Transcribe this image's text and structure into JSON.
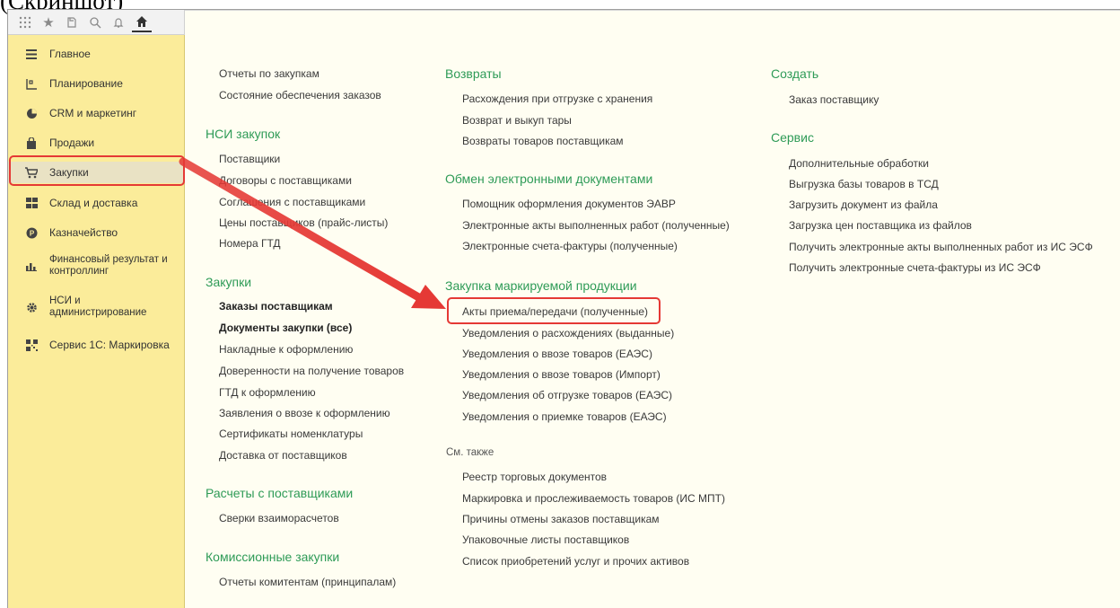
{
  "page_fragment": "(Скриншот)",
  "toolbar": {
    "icons": [
      "apps-grid-icon",
      "star-icon",
      "history-icon",
      "search-icon",
      "bell-icon",
      "home-icon"
    ]
  },
  "sidebar": {
    "items": [
      {
        "label": "Главное",
        "icon": "menu-lines-icon"
      },
      {
        "label": "Планирование",
        "icon": "planning-icon"
      },
      {
        "label": "CRM и маркетинг",
        "icon": "crm-pie-icon"
      },
      {
        "label": "Продажи",
        "icon": "shopping-bag-icon"
      },
      {
        "label": "Закупки",
        "icon": "cart-icon"
      },
      {
        "label": "Склад и доставка",
        "icon": "warehouse-icon"
      },
      {
        "label": "Казначейство",
        "icon": "coin-icon"
      },
      {
        "label": "Финансовый результат и контроллинг",
        "icon": "bar-chart-icon"
      },
      {
        "label": "НСИ и администрирование",
        "icon": "gear-icon"
      },
      {
        "label": "Сервис 1С: Маркировка",
        "icon": "qr-code-icon"
      }
    ],
    "active_index": 4
  },
  "col1": {
    "top_links": [
      "Отчеты по закупкам",
      "Состояние обеспечения заказов"
    ],
    "nsi_title": "НСИ закупок",
    "nsi_links": [
      "Поставщики",
      "Договоры с поставщиками",
      "Соглашения с поставщиками",
      "Цены поставщиков (прайс-листы)",
      "Номера ГТД"
    ],
    "purchases_title": "Закупки",
    "purchases_bold": [
      "Заказы поставщикам",
      "Документы закупки (все)"
    ],
    "purchases_links": [
      "Накладные к оформлению",
      "Доверенности на получение товаров",
      "ГТД к оформлению",
      "Заявления о ввозе к оформлению",
      "Сертификаты номенклатуры",
      "Доставка от поставщиков"
    ],
    "settlements_title": "Расчеты с поставщиками",
    "settlements_links": [
      "Сверки взаиморасчетов"
    ],
    "commission_title": "Комиссионные закупки",
    "commission_links": [
      "Отчеты комитентам (принципалам)"
    ]
  },
  "col2": {
    "returns_title": "Возвраты",
    "returns_links": [
      "Расхождения при отгрузке с хранения",
      "Возврат и выкуп тары",
      "Возвраты товаров поставщикам"
    ],
    "edo_title": "Обмен электронными документами",
    "edo_links": [
      "Помощник оформления документов ЭАВР",
      "Электронные акты выполненных работ (полученные)",
      "Электронные счета-фактуры (полученные)"
    ],
    "marked_title": "Закупка маркируемой продукции",
    "marked_links": [
      "Акты приема/передачи (полученные)",
      "Уведомления о расхождениях (выданные)",
      "Уведомления о ввозе товаров (ЕАЭС)",
      "Уведомления о ввозе товаров (Импорт)",
      "Уведомления об отгрузке товаров (ЕАЭС)",
      "Уведомления о приемке товаров (ЕАЭС)"
    ],
    "see_also_title": "См. также",
    "see_also_links": [
      "Реестр торговых документов",
      "Маркировка и прослеживаемость товаров (ИС МПТ)",
      "Причины отмены заказов поставщикам",
      "Упаковочные листы поставщиков",
      "Список приобретений услуг и прочих активов"
    ]
  },
  "col3": {
    "create_title": "Создать",
    "create_links": [
      "Заказ поставщику"
    ],
    "service_title": "Сервис",
    "service_links": [
      "Дополнительные обработки",
      "Выгрузка базы товаров в ТСД",
      "Загрузить документ из файла",
      "Загрузка цен поставщика из файлов",
      "Получить электронные акты выполненных работ из ИС ЭСФ",
      "Получить электронные счета-фактуры из ИС ЭСФ"
    ]
  },
  "colors": {
    "sidebar_bg": "#fbec9a",
    "content_bg": "#fffef2",
    "section_title": "#2e9b57",
    "highlight": "#e53935"
  }
}
